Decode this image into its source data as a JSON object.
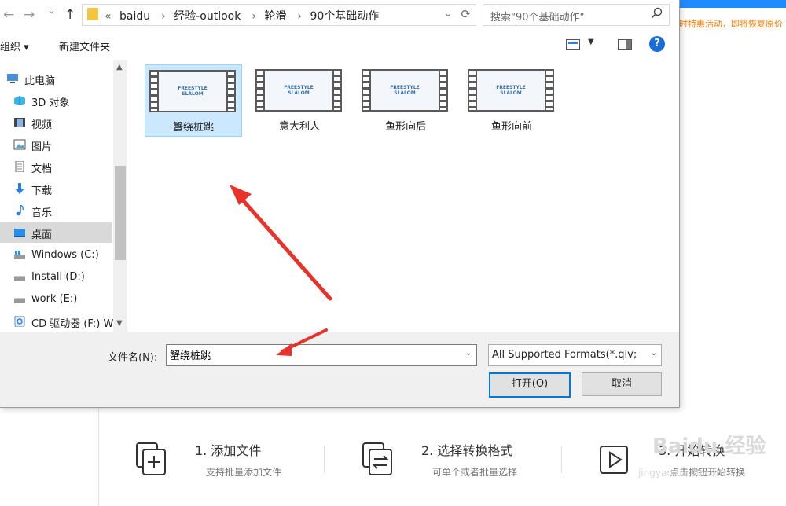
{
  "background_app": {
    "notice": "时特惠活动，即将恢复原价",
    "steps": [
      {
        "title": "1. 添加文件",
        "sub": "支持批量添加文件",
        "icon": "add-file-icon"
      },
      {
        "title": "2. 选择转换格式",
        "sub": "可单个或者批量选择",
        "icon": "convert-format-icon"
      },
      {
        "title": "3. 开始转换",
        "sub": "点击按钮开始转换",
        "icon": "play-icon"
      }
    ],
    "watermark": "Baidu 经验",
    "watermark_url": "jingyan.baidu.com"
  },
  "dialog": {
    "address": {
      "back": "←",
      "forward": "→",
      "recent": "⌄",
      "up": "↑",
      "overflow": "«",
      "crumbs": [
        "baidu",
        "经验-outlook",
        "轮滑",
        "90个基础动作"
      ]
    },
    "search_placeholder": "搜索\"90个基础动作\"",
    "toolbar": {
      "organize": "组织 ▾",
      "new_folder": "新建文件夹",
      "help": "?"
    },
    "nav": [
      {
        "label": "此电脑",
        "icon": "computer-icon"
      },
      {
        "label": "3D 对象",
        "icon": "3d-objects-icon"
      },
      {
        "label": "视频",
        "icon": "video-icon"
      },
      {
        "label": "图片",
        "icon": "pictures-icon"
      },
      {
        "label": "文档",
        "icon": "documents-icon"
      },
      {
        "label": "下载",
        "icon": "download-icon"
      },
      {
        "label": "音乐",
        "icon": "music-icon"
      },
      {
        "label": "桌面",
        "icon": "desktop-icon"
      },
      {
        "label": "Windows (C:)",
        "icon": "drive-icon"
      },
      {
        "label": "Install (D:)",
        "icon": "drive-icon"
      },
      {
        "label": "work (E:)",
        "icon": "drive-icon"
      },
      {
        "label": "CD 驱动器 (F:) W",
        "icon": "cd-drive-icon"
      }
    ],
    "files": [
      {
        "name": "蟹绕桩跳",
        "thumb_text": "FREESTYLE SLALOM"
      },
      {
        "name": "意大利人",
        "thumb_text": "FREESTYLE SLALOM"
      },
      {
        "name": "鱼形向后",
        "thumb_text": "FREESTYLE SLALOM"
      },
      {
        "name": "鱼形向前",
        "thumb_text": "FREESTYLE SLALOM"
      }
    ],
    "filename_label": "文件名(N):",
    "filename_value": "蟹绕桩跳",
    "filter_value": "All Supported Formats(*.qlv;",
    "open_button": "打开(O)",
    "cancel_button": "取消"
  },
  "colors": {
    "accent": "#0078d7",
    "selection": "#cce8ff",
    "annotation_arrow": "#e8322a"
  }
}
